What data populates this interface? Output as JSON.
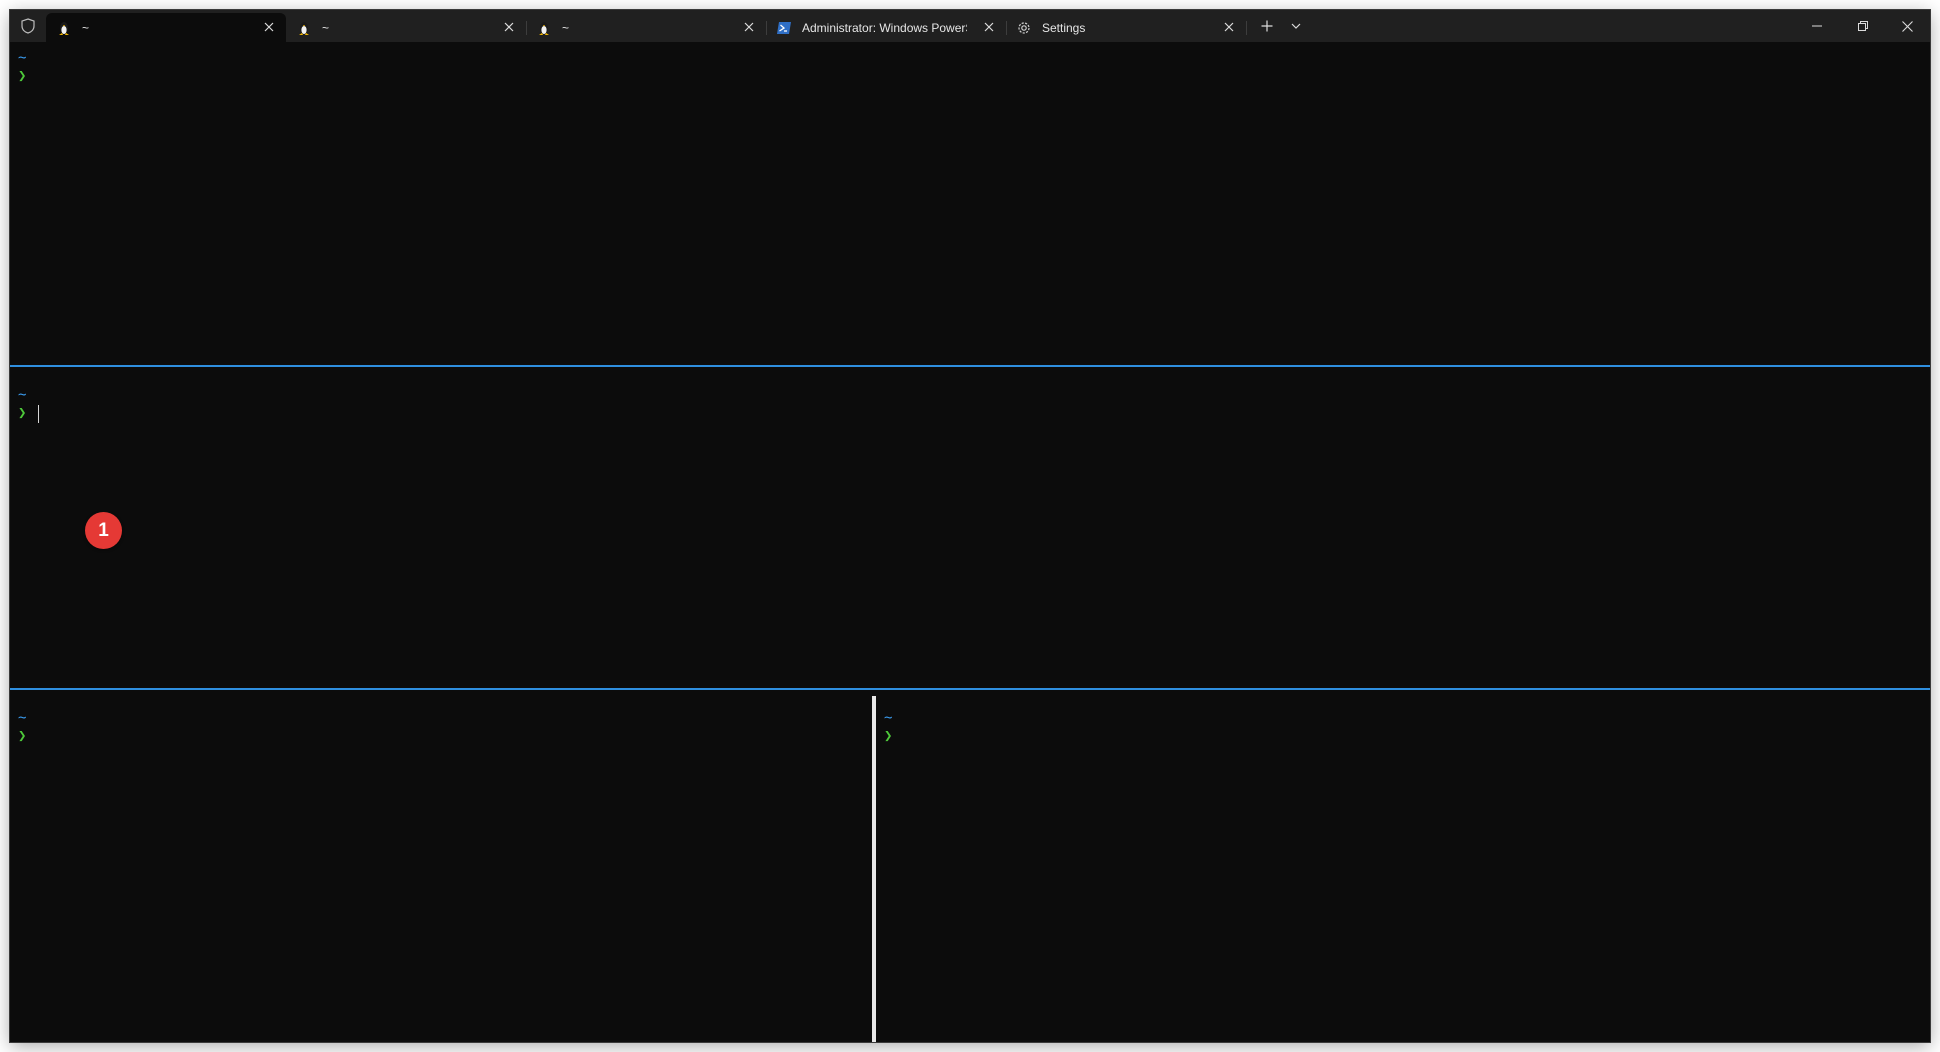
{
  "tabs": [
    {
      "title": "~",
      "icon": "linux-penguin-icon",
      "active": true
    },
    {
      "title": "~",
      "icon": "linux-penguin-icon",
      "active": false
    },
    {
      "title": "~",
      "icon": "linux-penguin-icon",
      "active": false
    },
    {
      "title": "Administrator: Windows PowerShell",
      "icon": "powershell-icon",
      "active": false
    },
    {
      "title": "Settings",
      "icon": "gear-icon",
      "active": false
    }
  ],
  "panes": [
    {
      "dir": "~",
      "arrow": "❯"
    },
    {
      "dir": "~",
      "arrow": "❯"
    },
    {
      "dir": "~",
      "arrow": "❯"
    },
    {
      "dir": "~",
      "arrow": "❯"
    }
  ],
  "annotation": {
    "label": "1"
  },
  "colors": {
    "background": "#0c0c0c",
    "titlebar": "#202020",
    "prompt_dir": "#3b9cf0",
    "prompt_arrow": "#4ec93a",
    "focus_border": "#2f8fe0",
    "badge": "#e53935"
  }
}
